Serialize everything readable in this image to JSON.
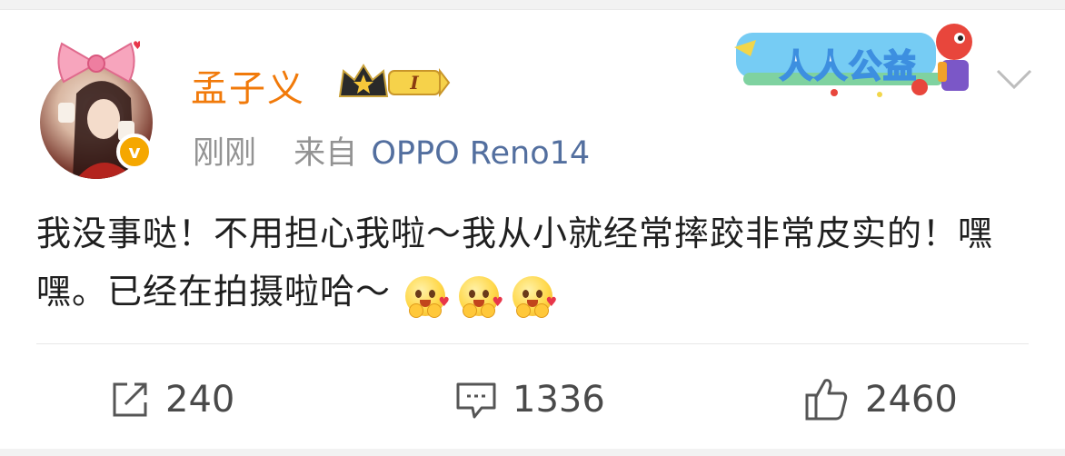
{
  "user": {
    "name": "孟子义",
    "level_badge": "I",
    "time": "刚刚",
    "source_prefix": "来自",
    "source_device": "OPPO Reno14"
  },
  "promo": {
    "text": "人人公益"
  },
  "post": {
    "text": "我没事哒！不用担心我啦～我从小就经常摔跤非常皮实的！嘿嘿。已经在拍摄啦哈～",
    "emojis": [
      "hug-emoji",
      "hug-emoji",
      "hug-emoji"
    ]
  },
  "actions": {
    "share_count": "240",
    "comment_count": "1336",
    "like_count": "2460"
  },
  "colors": {
    "username": "#f17a0a",
    "source_link": "#536f9f",
    "meta_gray": "#939393",
    "verified_badge": "#f5a700"
  }
}
